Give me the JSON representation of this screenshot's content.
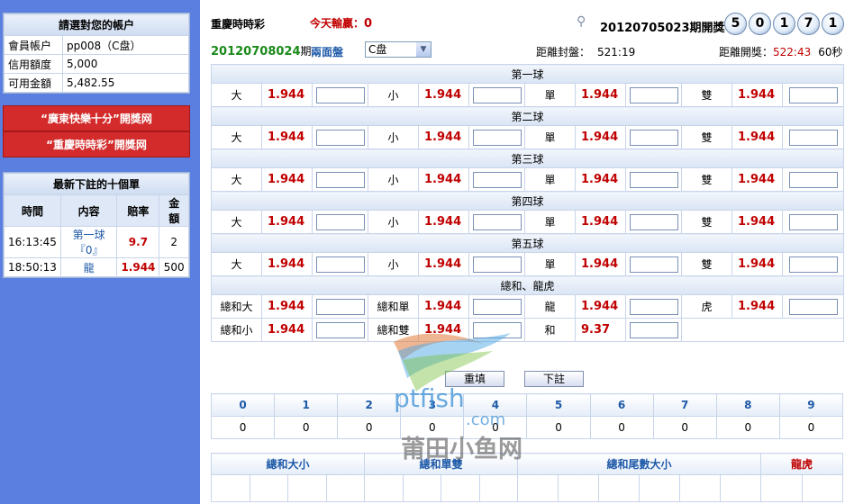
{
  "account": {
    "title": "請選對您的帳户",
    "rows": [
      {
        "label": "會員帳户",
        "value": "pp008（C盘）"
      },
      {
        "label": "信用額度",
        "value": "5,000"
      },
      {
        "label": "可用金額",
        "value": "5,482.55"
      }
    ]
  },
  "red_buttons": [
    "“廣東快樂十分”開獎网",
    "“重慶時時彩”開獎网"
  ],
  "recent": {
    "title": "最新下註的十個單",
    "headers": [
      "時間",
      "内容",
      "賠率",
      "金額"
    ],
    "rows": [
      {
        "time": "16:13:45",
        "content": "第一球『0』",
        "odds": "9.7",
        "amount": "2"
      },
      {
        "time": "18:50:13",
        "content": "龍",
        "odds": "1.944",
        "amount": "500"
      }
    ]
  },
  "header": {
    "game": "重慶時時彩",
    "today_label": "今天輸贏：",
    "today_value": "0",
    "draw_period": "20120705023期開獎",
    "balls": [
      "5",
      "0",
      "1",
      "7",
      "1"
    ],
    "current_period": "20120708024",
    "period_suffix": "期",
    "board_type": "兩面盤",
    "plate_select": "C盘",
    "close_label": "距離封盤：",
    "close_value": "521:19",
    "open_label": "距離開獎：",
    "open_value": "522:43",
    "refresh": "60秒"
  },
  "sections": [
    {
      "title": "第一球"
    },
    {
      "title": "第二球"
    },
    {
      "title": "第三球"
    },
    {
      "title": "第四球"
    },
    {
      "title": "第五球"
    }
  ],
  "ball_bets": [
    {
      "label": "大",
      "odds": "1.944"
    },
    {
      "label": "小",
      "odds": "1.944"
    },
    {
      "label": "單",
      "odds": "1.944"
    },
    {
      "label": "雙",
      "odds": "1.944"
    }
  ],
  "sum_section": {
    "title": "總和、龍虎",
    "row1": [
      {
        "label": "總和大",
        "odds": "1.944"
      },
      {
        "label": "總和單",
        "odds": "1.944"
      },
      {
        "label": "龍",
        "odds": "1.944"
      },
      {
        "label": "虎",
        "odds": "1.944"
      }
    ],
    "row2": [
      {
        "label": "總和小",
        "odds": "1.944"
      },
      {
        "label": "總和雙",
        "odds": "1.944"
      },
      {
        "label": "和",
        "odds": "9.37"
      }
    ]
  },
  "buttons": {
    "reset": "重填",
    "submit": "下註"
  },
  "tail_stats": {
    "headers": [
      "0",
      "1",
      "2",
      "3",
      "4",
      "5",
      "6",
      "7",
      "8",
      "9"
    ],
    "values": [
      "0",
      "0",
      "0",
      "0",
      "0",
      "0",
      "0",
      "0",
      "0",
      "0"
    ]
  },
  "sum_stats": {
    "headers": [
      "總和大小",
      "總和單雙",
      "總和尾數大小",
      "龍虎"
    ]
  },
  "watermark": {
    "brand": "ptfish",
    "domain": ".com",
    "cn": "莆田小鱼网"
  },
  "colors": {
    "sidebar": "#5b7fe0",
    "odds": "#c00000",
    "period": "#1a8a1a",
    "red_button": "#d32b2b"
  }
}
